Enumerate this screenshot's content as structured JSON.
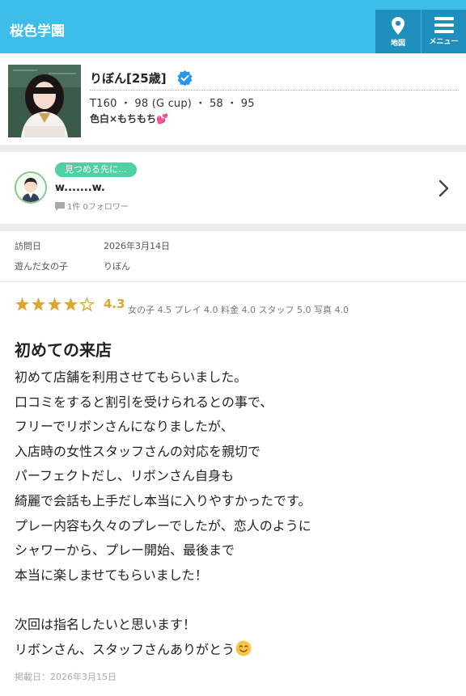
{
  "header": {
    "shop_name": "桜色学園",
    "map_label": "地図",
    "menu_label": "メニュー"
  },
  "profile": {
    "name": "りぼん[25歳]",
    "specs": "T160 ・ 98 (G cup) ・ 58 ・ 95",
    "catchphrase": "色白×もちもち💕"
  },
  "reviewer": {
    "tag": "見つめる先に...",
    "name": "w.......w.",
    "stats": "1件 0フォロワー"
  },
  "visit": {
    "date_label": "訪問日",
    "date_value": "2026年3月14日",
    "girl_label": "遊んだ女の子",
    "girl_value": "りぼん"
  },
  "rating": {
    "score": "4.3",
    "stars_value": 4.3,
    "subscores": "女の子 4.5 プレイ 4.0 料金 4.0 スタッフ 5.0 写真 4.0"
  },
  "review": {
    "title": "初めての来店",
    "lines": [
      "初めて店舗を利用させてもらいました。",
      "口コミをすると割引を受けられるとの事で、",
      "フリーでリボンさんになりましたが、",
      "入店時の女性スタッフさんの対応を親切で",
      "パーフェクトだし、リボンさん自身も",
      "綺麗で会話も上手だし本当に入りやすかったです。",
      "プレー内容も久々のプレーでしたが、恋人のように",
      "シャワーから、プレー開始、最後まで",
      "本当に楽しませてもらいました！",
      "",
      "次回は指名したいと思います！",
      "リボンさん、スタッフさんありがとう"
    ],
    "posted": "掲載日：2026年3月15日"
  },
  "colors": {
    "header_bg": "#3cbdea",
    "header_button_bg": "#1f8fbe",
    "star": "#e0a431",
    "tag_bg": "#4fd1a4",
    "verified": "#2196f3"
  }
}
